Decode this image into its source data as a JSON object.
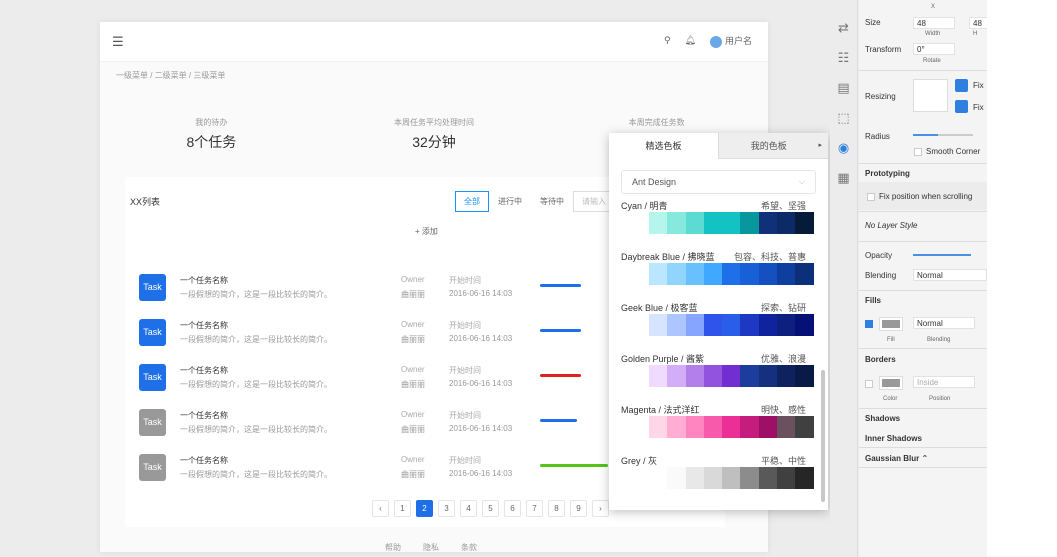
{
  "topbar": {
    "user": "用户名"
  },
  "breadcrumb": "一级菜单 / 二级菜单 / 三级菜单",
  "stats": [
    {
      "label": "我的待办",
      "value": "8个任务"
    },
    {
      "label": "本周任务平均处理时间",
      "value": "32分钟"
    },
    {
      "label": "本周完成任务数",
      "value": ""
    }
  ],
  "card": {
    "title": "XX列表",
    "filters": [
      "全部",
      "进行中",
      "等待中",
      "请输入"
    ],
    "add": "+ 添加"
  },
  "rows": [
    {
      "task": "Task",
      "name": "一个任务名称",
      "desc": "一段假想的简介，这是一段比较长的简介。",
      "owner_label": "Owner",
      "owner": "曲丽丽",
      "start_label": "开始时间",
      "start": "2016-06-16 14:03",
      "color": "#1f6fe8",
      "bar": "#1f6fe8",
      "progress": 0.6
    },
    {
      "task": "Task",
      "name": "一个任务名称",
      "desc": "一段假想的简介，这是一段比较长的简介。",
      "owner_label": "Owner",
      "owner": "曲丽丽",
      "start_label": "开始时间",
      "start": "2016-06-16 14:03",
      "color": "#1f6fe8",
      "bar": "#1f6fe8",
      "progress": 0.6
    },
    {
      "task": "Task",
      "name": "一个任务名称",
      "desc": "一段假想的简介，这是一段比较长的简介。",
      "owner_label": "Owner",
      "owner": "曲丽丽",
      "start_label": "开始时间",
      "start": "2016-06-16 14:03",
      "color": "#1f6fe8",
      "bar": "#e02020",
      "progress": 0.6
    },
    {
      "task": "Task",
      "name": "一个任务名称",
      "desc": "一段假想的简介，这是一段比较长的简介。",
      "owner_label": "Owner",
      "owner": "曲丽丽",
      "start_label": "开始时间",
      "start": "2016-06-16 14:03",
      "color": "#999999",
      "bar": "#1f6fe8",
      "progress": 0.55
    },
    {
      "task": "Task",
      "name": "一个任务名称",
      "desc": "一段假想的简介，这是一段比较长的简介。",
      "owner_label": "Owner",
      "owner": "曲丽丽",
      "start_label": "开始时间",
      "start": "2016-06-16 14:03",
      "color": "#999999",
      "bar": "#52c41a",
      "progress": 1.0
    }
  ],
  "pager": [
    "‹",
    "1",
    "2",
    "3",
    "4",
    "5",
    "6",
    "7",
    "8",
    "9",
    "›"
  ],
  "pager_current": "2",
  "footer": [
    "帮助",
    "隐私",
    "条款"
  ],
  "popover": {
    "tabs": [
      "精选色板",
      "我的色板"
    ],
    "select": "Ant Design",
    "palettes": [
      {
        "name": "Cyan / 明青",
        "desc": "希望、坚强",
        "colors": [
          "#b5f5ec",
          "#87e8de",
          "#5cdbd3",
          "#13c2c2",
          "#13c2c2",
          "#08979c",
          "#10317a",
          "#0c2a66",
          "#061a3a"
        ]
      },
      {
        "name": "Daybreak Blue / 拂晓蓝",
        "desc": "包容、科技、普惠",
        "colors": [
          "#bae7ff",
          "#91d5ff",
          "#69c0ff",
          "#40a9ff",
          "#1f6fe8",
          "#1860d8",
          "#1550c0",
          "#0e3ea0",
          "#0c2f7a"
        ]
      },
      {
        "name": "Geek Blue / 极客蓝",
        "desc": "探索、钻研",
        "colors": [
          "#d6e4ff",
          "#adc6ff",
          "#85a5ff",
          "#2f54eb",
          "#2a5ee8",
          "#1d39c4",
          "#10239e",
          "#0d2080",
          "#061178"
        ]
      },
      {
        "name": "Golden Purple / 酱紫",
        "desc": "优雅、浪漫",
        "colors": [
          "#efdbff",
          "#d3adf7",
          "#b37feb",
          "#9254de",
          "#722ed1",
          "#1d3d9e",
          "#163080",
          "#0e2260",
          "#0a1a48"
        ]
      },
      {
        "name": "Magenta / 法式洋红",
        "desc": "明快、感性",
        "colors": [
          "#ffd6e7",
          "#ffadd2",
          "#ff85c0",
          "#f759ab",
          "#eb2f96",
          "#c41d7f",
          "#9e1068",
          "#6b5060",
          "#404040"
        ]
      },
      {
        "name": "Grey / 灰",
        "desc": "平稳、中性",
        "colors": [
          "#ffffff",
          "#fafafa",
          "#e8e8e8",
          "#d9d9d9",
          "#bfbfbf",
          "#8c8c8c",
          "#595959",
          "#404040",
          "#262626"
        ]
      }
    ]
  },
  "inspector": {
    "x_label": "X",
    "size_label": "Size",
    "width": "48",
    "height": "48",
    "width_label": "Width",
    "height_label": "H",
    "transform_label": "Transform",
    "rotate": "0°",
    "rotate_label": "Rotate",
    "resizing_label": "Resizing",
    "fix1": "Fix",
    "fix2": "Fix",
    "radius_label": "Radius",
    "smooth": "Smooth Corner",
    "prototyping": "Prototyping",
    "fix_pos": "Fix position when scrolling",
    "layer_style": "No Layer Style",
    "opacity": "Opacity",
    "blending": "Blending",
    "blending_value": "Normal",
    "fills": "Fills",
    "fill_blend": "Normal",
    "fill_label": "Fill",
    "fill_blend_label": "Blending",
    "borders": "Borders",
    "border_pos": "Inside",
    "color_label": "Color",
    "position_label": "Position",
    "shadows": "Shadows",
    "inner_shadows": "Inner Shadows",
    "gaussian": "Gaussian Blur ⌃"
  }
}
